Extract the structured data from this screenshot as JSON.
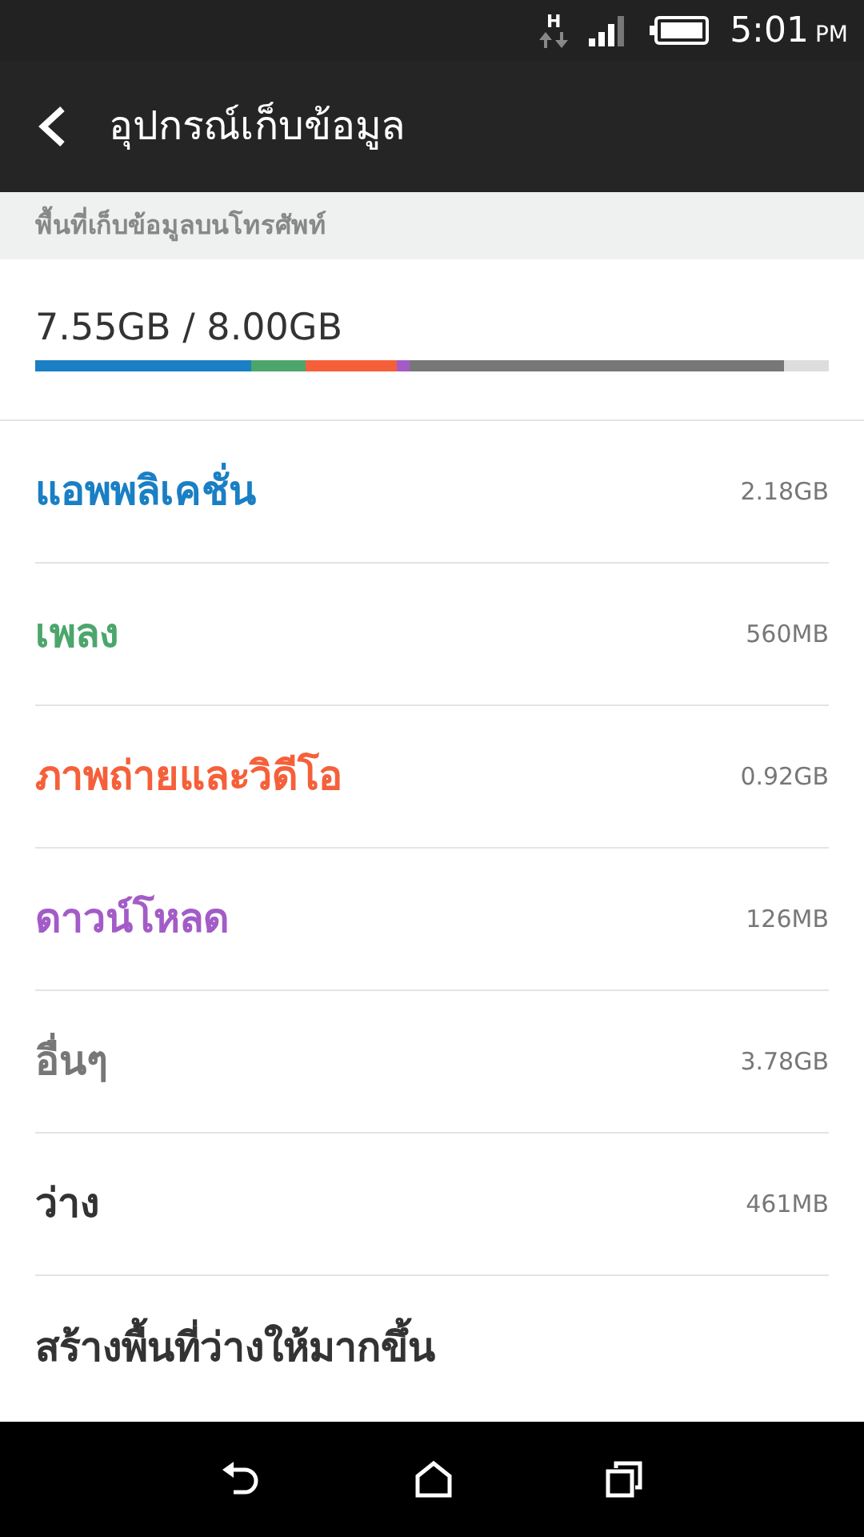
{
  "status_bar": {
    "network": "H",
    "time": "5:01",
    "ampm": "PM"
  },
  "app_bar": {
    "title": "อุปกรณ์เก็บข้อมูล"
  },
  "section_header": "พื้นที่เก็บข้อมูลบนโทรศัพท์",
  "usage": {
    "reading": "7.55GB / 8.00GB"
  },
  "items": [
    {
      "kind": "category",
      "label": "แอพพลิเคชั่น",
      "size": "2.18GB",
      "color": "#1a7fc4"
    },
    {
      "kind": "category",
      "label": "เพลง",
      "size": "560MB",
      "color": "#4ca66c"
    },
    {
      "kind": "category",
      "label": "ภาพถ่ายและวิดีโอ",
      "size": "0.92GB",
      "color": "#f5603a"
    },
    {
      "kind": "category",
      "label": "ดาวน์โหลด",
      "size": "126MB",
      "color": "#a35cc7"
    },
    {
      "kind": "category",
      "label": "อื่นๆ",
      "size": "3.78GB",
      "color": "#777777"
    },
    {
      "kind": "free",
      "label": "ว่าง",
      "size": "461MB",
      "color": "#dddddd"
    },
    {
      "kind": "action",
      "label": "สร้างพื้นที่ว่างให้มากขึ้น"
    }
  ]
}
